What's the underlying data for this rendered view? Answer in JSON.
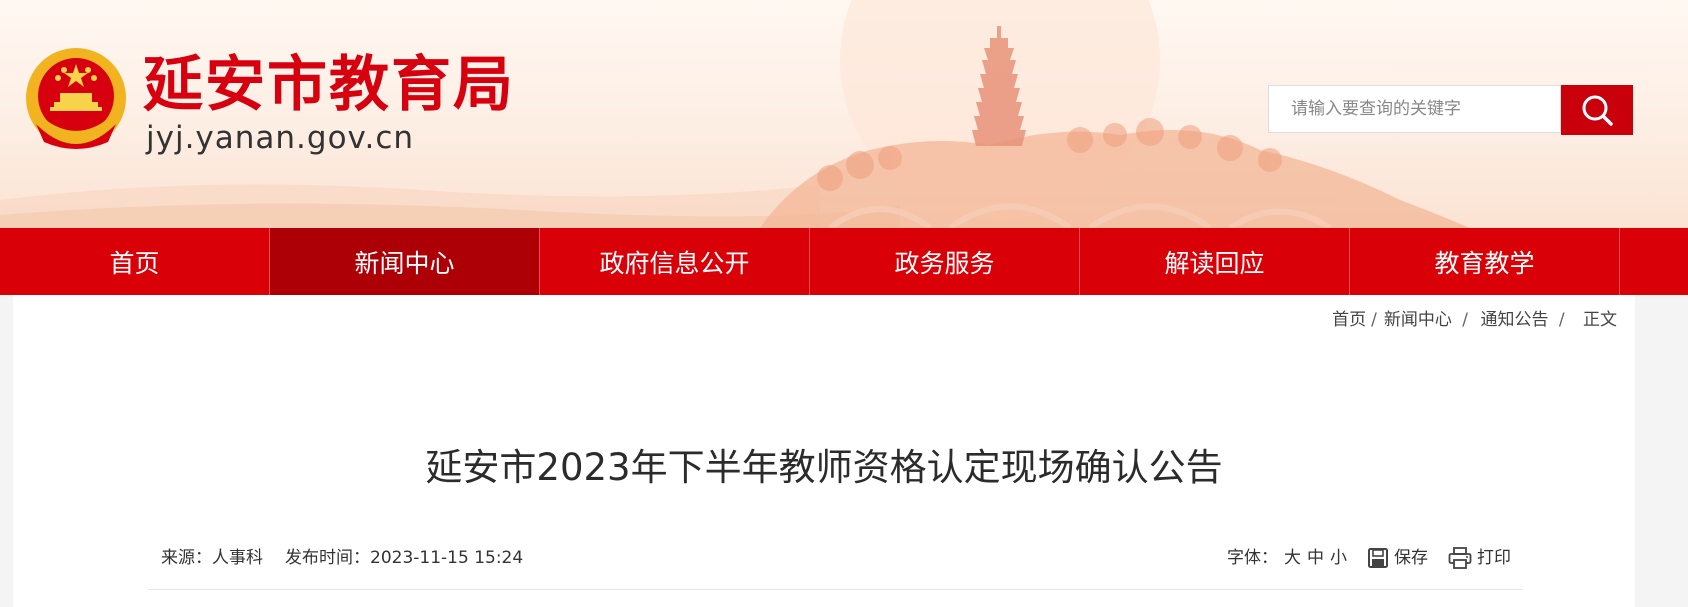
{
  "header": {
    "site_name": "延安市教育局",
    "site_domain": "jyj.yanan.gov.cn",
    "emblem_icon": "national-emblem-icon"
  },
  "search": {
    "placeholder": "请输入要查询的关键字",
    "button_icon": "search-icon"
  },
  "nav": {
    "items": [
      {
        "label": "首页"
      },
      {
        "label": "新闻中心"
      },
      {
        "label": "政府信息公开"
      },
      {
        "label": "政务服务"
      },
      {
        "label": "解读回应"
      },
      {
        "label": "教育教学"
      }
    ],
    "active_index": 1
  },
  "breadcrumb": {
    "items": [
      "首页",
      "新闻中心",
      "通知公告",
      "正文"
    ]
  },
  "article": {
    "title": "延安市2023年下半年教师资格认定现场确认公告",
    "source_label": "来源：",
    "source": "人事科",
    "publish_label": "发布时间：",
    "publish_time": "2023-11-15 15:24",
    "font_label": "字体：",
    "font_large": "大",
    "font_medium": "中",
    "font_small": "小",
    "save_label": "保存",
    "print_label": "打印"
  },
  "colors": {
    "brand_red": "#d90008",
    "nav_active": "#ad0006",
    "search_button": "#c9000c"
  }
}
